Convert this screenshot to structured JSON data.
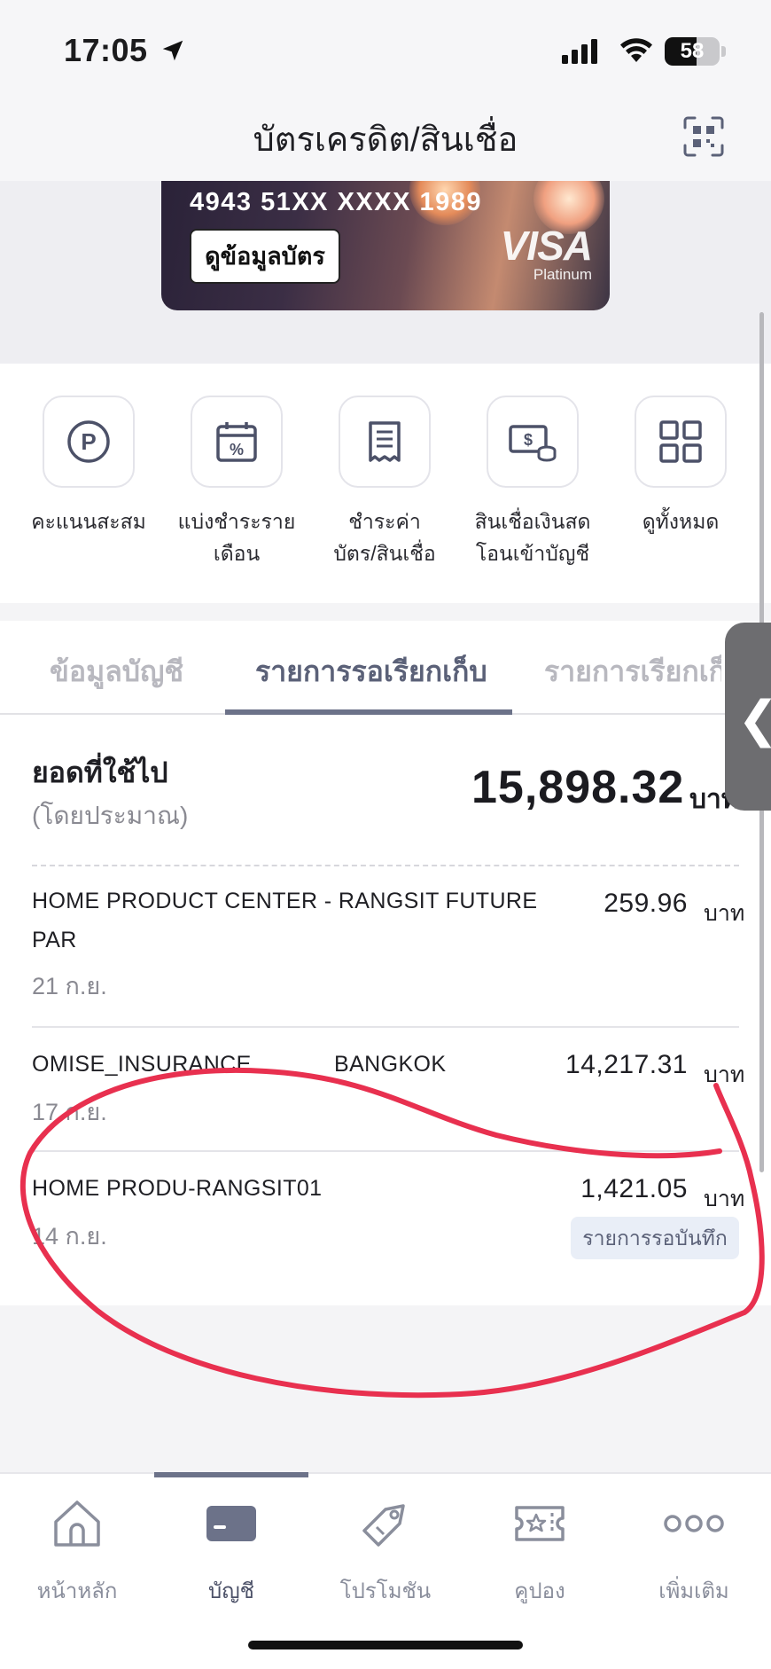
{
  "status_bar": {
    "time": "17:05",
    "battery": "58"
  },
  "header": {
    "title": "บัตรเครดิต/สินเชื่อ"
  },
  "card": {
    "number": "4943 51XX XXXX 1989",
    "view_button": "ดูข้อมูลบัตร",
    "brand": "VISA",
    "tier": "Platinum"
  },
  "quick_actions": [
    {
      "line1": "คะแนนสะสม",
      "line2": "",
      "icon": "points-icon"
    },
    {
      "line1": "แบ่งชำระราย",
      "line2": "เดือน",
      "icon": "installment-calendar-icon"
    },
    {
      "line1": "ชำระค่า",
      "line2": "บัตร/สินเชื่อ",
      "icon": "bill-receipt-icon"
    },
    {
      "line1": "สินเชื่อเงินสด",
      "line2": "โอนเข้าบัญชี",
      "icon": "cash-loan-icon"
    },
    {
      "line1": "ดูทั้งหมด",
      "line2": "",
      "icon": "grid-icon"
    }
  ],
  "tabs": [
    {
      "label": "ข้อมูลบัญชี",
      "active": false
    },
    {
      "label": "รายการรอเรียกเก็บ",
      "active": true
    },
    {
      "label": "รายการเรียกเก็",
      "active": false
    }
  ],
  "summary": {
    "label": "ยอดที่ใช้ไป",
    "sublabel": "(โดยประมาณ)",
    "amount": "15,898.32",
    "unit": "บาท"
  },
  "transactions": [
    {
      "name_line1": "HOME PRODUCT CENTER - RANGSIT FUTURE",
      "name_line2": "PAR",
      "location": "",
      "date": "21 ก.ย.",
      "amount": "259.96",
      "unit": "บาท",
      "status": ""
    },
    {
      "name_line1": "OMISE_INSURANCE",
      "name_line2": "",
      "location": "BANGKOK",
      "date": "17 ก.ย.",
      "amount": "14,217.31",
      "unit": "บาท",
      "status": ""
    },
    {
      "name_line1": "HOME PRODU-RANGSIT01",
      "name_line2": "",
      "location": "",
      "date": "14 ก.ย.",
      "amount": "1,421.05",
      "unit": "บาท",
      "status": "รายการรอบันทึก"
    }
  ],
  "nav": [
    {
      "label": "หน้าหลัก",
      "icon": "home-icon",
      "active": false
    },
    {
      "label": "บัญชี",
      "icon": "card-icon",
      "active": true
    },
    {
      "label": "โปรโมชัน",
      "icon": "tag-icon",
      "active": false
    },
    {
      "label": "คูปอง",
      "icon": "coupon-icon",
      "active": false
    },
    {
      "label": "เพิ่มเติม",
      "icon": "more-icon",
      "active": false
    }
  ],
  "colors": {
    "accent": "#6c7289",
    "annotation": "#e8304f",
    "pending_bg": "#e9eef7"
  }
}
